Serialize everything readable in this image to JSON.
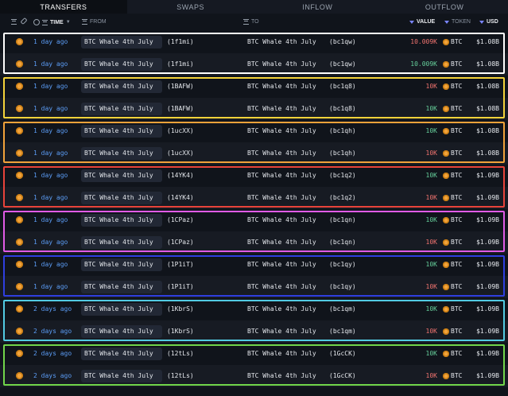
{
  "tabs": [
    "TRANSFERS",
    "SWAPS",
    "INFLOW",
    "OUTFLOW"
  ],
  "active_tab": 0,
  "columns": {
    "time": "TIME",
    "from": "FROM",
    "to": "TO",
    "value": "VALUE",
    "token": "TOKEN",
    "usd": "USD"
  },
  "frame_colors": [
    "#ffffff",
    "#f5d33a",
    "#f2a23a",
    "#e8433a",
    "#e05be6",
    "#2f3fe0",
    "#52cbe3",
    "#71d64a"
  ],
  "rows": [
    {
      "time": "1 day ago",
      "from": "BTC Whale 4th July",
      "from_tag": "(1f1mi)",
      "to": "BTC Whale 4th July",
      "to_tag": "(bc1qw)",
      "value": "10.009K",
      "value_color": "red",
      "token": "BTC",
      "usd": "$1.08B"
    },
    {
      "time": "1 day ago",
      "from": "BTC Whale 4th July",
      "from_tag": "(1f1mi)",
      "to": "BTC Whale 4th July",
      "to_tag": "(bc1qw)",
      "value": "10.009K",
      "value_color": "green",
      "token": "BTC",
      "usd": "$1.08B"
    },
    {
      "time": "1 day ago",
      "from": "BTC Whale 4th July",
      "from_tag": "(1BAFW)",
      "to": "BTC Whale 4th July",
      "to_tag": "(bc1q8)",
      "value": "10K",
      "value_color": "red",
      "token": "BTC",
      "usd": "$1.08B"
    },
    {
      "time": "1 day ago",
      "from": "BTC Whale 4th July",
      "from_tag": "(1BAFW)",
      "to": "BTC Whale 4th July",
      "to_tag": "(bc1q8)",
      "value": "10K",
      "value_color": "green",
      "token": "BTC",
      "usd": "$1.08B"
    },
    {
      "time": "1 day ago",
      "from": "BTC Whale 4th July",
      "from_tag": "(1ucXX)",
      "to": "BTC Whale 4th July",
      "to_tag": "(bc1qh)",
      "value": "10K",
      "value_color": "green",
      "token": "BTC",
      "usd": "$1.08B"
    },
    {
      "time": "1 day ago",
      "from": "BTC Whale 4th July",
      "from_tag": "(1ucXX)",
      "to": "BTC Whale 4th July",
      "to_tag": "(bc1qh)",
      "value": "10K",
      "value_color": "red",
      "token": "BTC",
      "usd": "$1.08B"
    },
    {
      "time": "1 day ago",
      "from": "BTC Whale 4th July",
      "from_tag": "(14YK4)",
      "to": "BTC Whale 4th July",
      "to_tag": "(bc1q2)",
      "value": "10K",
      "value_color": "green",
      "token": "BTC",
      "usd": "$1.09B"
    },
    {
      "time": "1 day ago",
      "from": "BTC Whale 4th July",
      "from_tag": "(14YK4)",
      "to": "BTC Whale 4th July",
      "to_tag": "(bc1q2)",
      "value": "10K",
      "value_color": "red",
      "token": "BTC",
      "usd": "$1.09B"
    },
    {
      "time": "1 day ago",
      "from": "BTC Whale 4th July",
      "from_tag": "(1CPaz)",
      "to": "BTC Whale 4th July",
      "to_tag": "(bc1qn)",
      "value": "10K",
      "value_color": "green",
      "token": "BTC",
      "usd": "$1.09B"
    },
    {
      "time": "1 day ago",
      "from": "BTC Whale 4th July",
      "from_tag": "(1CPaz)",
      "to": "BTC Whale 4th July",
      "to_tag": "(bc1qn)",
      "value": "10K",
      "value_color": "red",
      "token": "BTC",
      "usd": "$1.09B"
    },
    {
      "time": "1 day ago",
      "from": "BTC Whale 4th July",
      "from_tag": "(1P1iT)",
      "to": "BTC Whale 4th July",
      "to_tag": "(bc1qy)",
      "value": "10K",
      "value_color": "green",
      "token": "BTC",
      "usd": "$1.09B"
    },
    {
      "time": "1 day ago",
      "from": "BTC Whale 4th July",
      "from_tag": "(1P1iT)",
      "to": "BTC Whale 4th July",
      "to_tag": "(bc1qy)",
      "value": "10K",
      "value_color": "red",
      "token": "BTC",
      "usd": "$1.09B"
    },
    {
      "time": "2 days ago",
      "from": "BTC Whale 4th July",
      "from_tag": "(1KbrS)",
      "to": "BTC Whale 4th July",
      "to_tag": "(bc1qm)",
      "value": "10K",
      "value_color": "green",
      "token": "BTC",
      "usd": "$1.09B"
    },
    {
      "time": "2 days ago",
      "from": "BTC Whale 4th July",
      "from_tag": "(1KbrS)",
      "to": "BTC Whale 4th July",
      "to_tag": "(bc1qm)",
      "value": "10K",
      "value_color": "red",
      "token": "BTC",
      "usd": "$1.09B"
    },
    {
      "time": "2 days ago",
      "from": "BTC Whale 4th July",
      "from_tag": "(12tLs)",
      "to": "BTC Whale 4th July",
      "to_tag": "(1GcCK)",
      "value": "10K",
      "value_color": "green",
      "token": "BTC",
      "usd": "$1.09B"
    },
    {
      "time": "2 days ago",
      "from": "BTC Whale 4th July",
      "from_tag": "(12tLs)",
      "to": "BTC Whale 4th July",
      "to_tag": "(1GcCK)",
      "value": "10K",
      "value_color": "red",
      "token": "BTC",
      "usd": "$1.09B"
    }
  ]
}
